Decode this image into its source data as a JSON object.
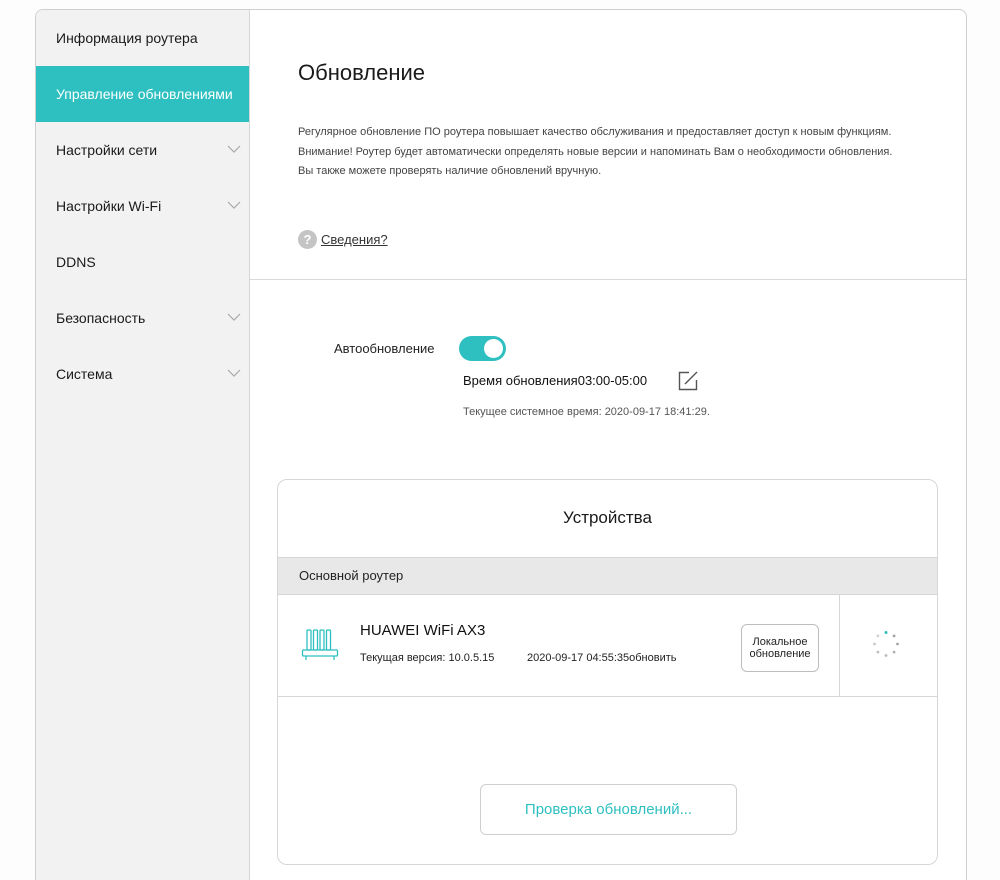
{
  "sidebar": {
    "items": [
      {
        "label": "Информация роутера",
        "active": false,
        "has_chevron": false
      },
      {
        "label": "Управление обновлениями",
        "active": true,
        "has_chevron": false
      },
      {
        "label": "Настройки сети",
        "active": false,
        "has_chevron": true
      },
      {
        "label": "Настройки Wi-Fi",
        "active": false,
        "has_chevron": true
      },
      {
        "label": "DDNS",
        "active": false,
        "has_chevron": false
      },
      {
        "label": "Безопасность",
        "active": false,
        "has_chevron": true
      },
      {
        "label": "Система",
        "active": false,
        "has_chevron": true
      }
    ]
  },
  "main": {
    "title": "Обновление",
    "description_line1": "Регулярное обновление ПО роутера повышает качество обслуживания и предоставляет доступ к новым функциям.",
    "description_line2": "Внимание! Роутер будет автоматически определять новые версии и напоминать Вам о необходимости обновления. Вы также можете проверять наличие обновлений вручную.",
    "details_link": "Сведения?",
    "help_icon_glyph": "?"
  },
  "auto_update": {
    "label": "Автообновление",
    "enabled": true,
    "update_time_text": "Время обновления03:00-05:00",
    "system_time_text": "Текущее системное время: 2020-09-17 18:41:29."
  },
  "devices": {
    "title": "Устройства",
    "group_header": "Основной роутер",
    "device": {
      "name": "HUAWEI WiFi AX3",
      "version_text": "Текущая версия: 10.0.5.15",
      "date_text": "2020-09-17 04:55:35обновить",
      "local_update_line1": "Локальное",
      "local_update_line2": "обновление"
    },
    "check_button": "Проверка обновлений..."
  },
  "colors": {
    "accent": "#2ebfc0",
    "sidebar_bg": "#f2f2f2",
    "header_bg": "#e8e8e8"
  },
  "icons": {
    "chevron": "chevron-down-icon",
    "help": "help-icon",
    "edit": "edit-icon",
    "router": "router-icon",
    "spinner": "loading-spinner-icon"
  }
}
